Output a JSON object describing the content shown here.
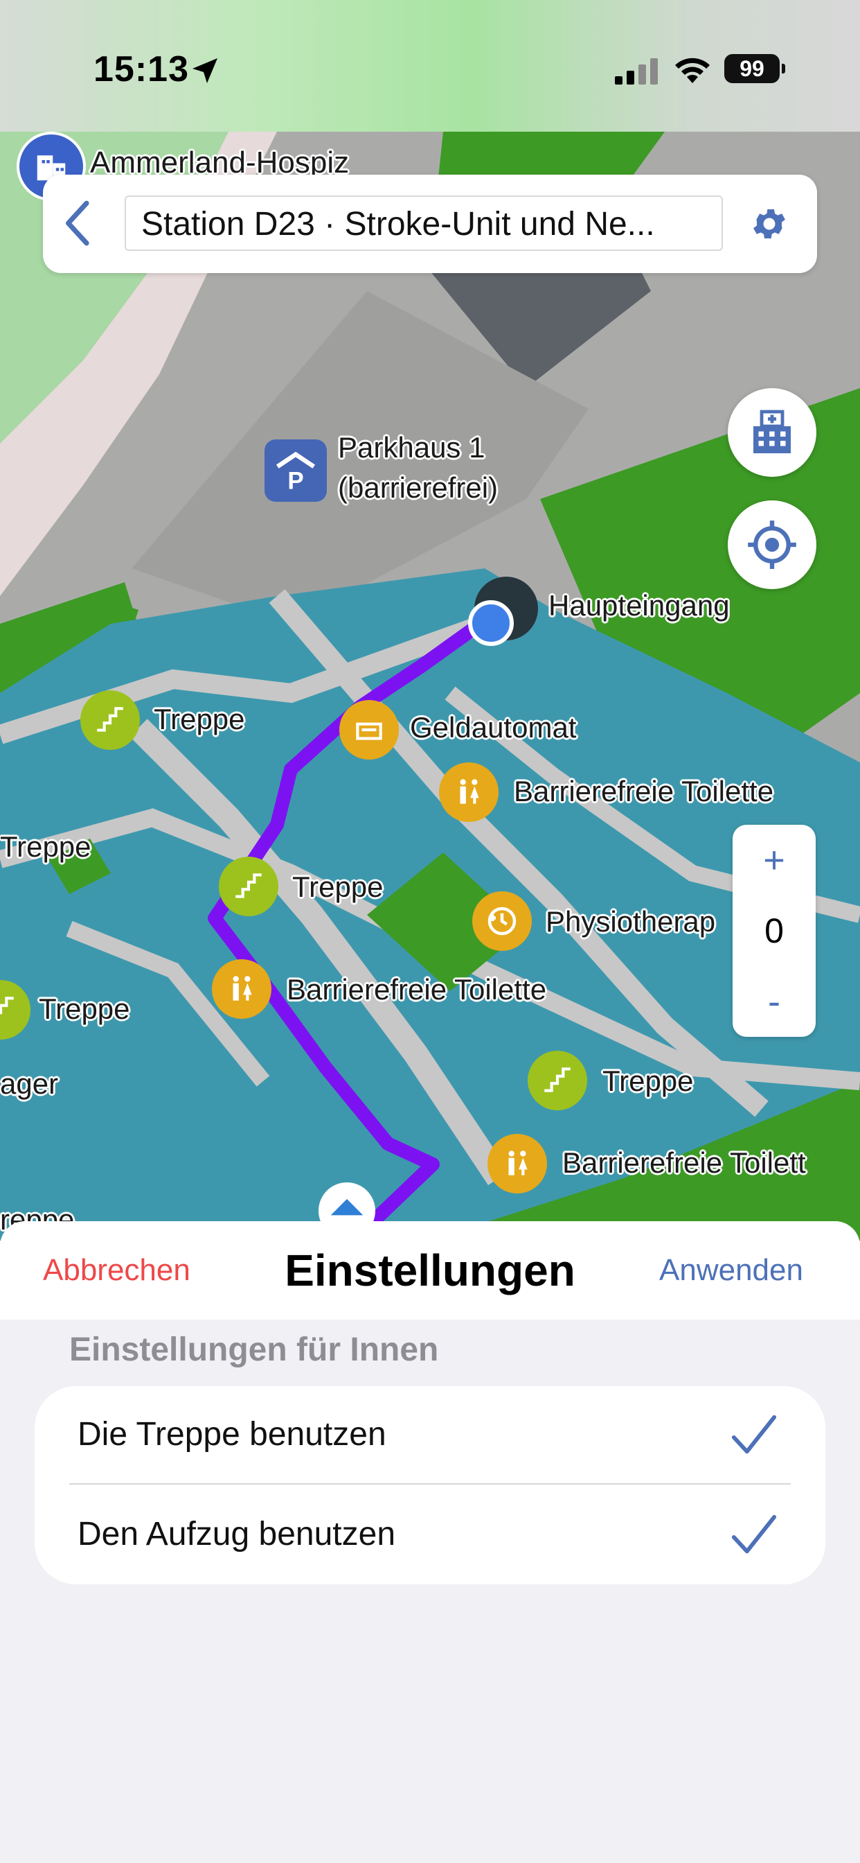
{
  "status_bar": {
    "time": "15:13",
    "battery": "99"
  },
  "map": {
    "top_label": "Ammerland-Hospiz",
    "parking_label_line1": "Parkhaus 1",
    "parking_label_line2": "(barrierefrei)",
    "labels": {
      "haupteingang": "Haupteingang",
      "treppe_1": "Treppe",
      "geldautomat": "Geldautomat",
      "barrierefreie_toilette_1": "Barrierefreie Toilette",
      "treppe_left": "Treppe",
      "treppe_2": "Treppe",
      "physiotherapie": "Physiotherap",
      "barrierefreie_toilette_2": "Barrierefreie Toilette",
      "treppe_3": "Treppe",
      "lager": "ager",
      "treppe_4": "Treppe",
      "barrierefreie_toilette_3": "Barrierefreie Toilett",
      "treppe_bottom": "reppe"
    },
    "route_color": "#7c12f2"
  },
  "topbar": {
    "search_value": "Station D23 · Stroke-Unit und Ne..."
  },
  "zoom": {
    "plus": "+",
    "level": "0",
    "minus": "-"
  },
  "sheet": {
    "cancel_label": "Abbrechen",
    "title": "Einstellungen",
    "apply_label": "Anwenden",
    "section_title": "Einstellungen für Innen",
    "options": [
      {
        "label": "Die Treppe benutzen",
        "checked": true
      },
      {
        "label": "Den Aufzug benutzen",
        "checked": true
      }
    ]
  },
  "colors": {
    "accent": "#4d71b8",
    "danger": "#ee4848",
    "map_building": "#3e98ad",
    "map_green": "#3d9a25"
  }
}
